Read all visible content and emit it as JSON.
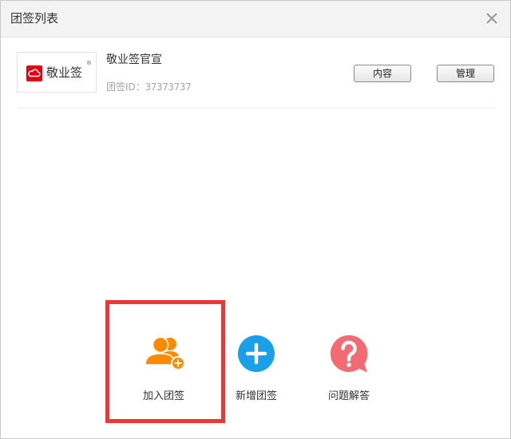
{
  "window": {
    "title": "团签列表"
  },
  "team": {
    "logo_text": "敬业签",
    "logo_reg": "®",
    "name": "敬业签官宣",
    "id_label": "团签ID：",
    "id_value": "37373737",
    "content_button": "内容",
    "manage_button": "管理"
  },
  "actions": {
    "join_label": "加入团签",
    "new_label": "新增团签",
    "faq_label": "问题解答",
    "join_color": "#ff8a00",
    "new_color": "#1aa0e8",
    "faq_color": "#f46a72"
  },
  "colors": {
    "highlight": "#ee3537",
    "brand_red": "#e60012"
  }
}
